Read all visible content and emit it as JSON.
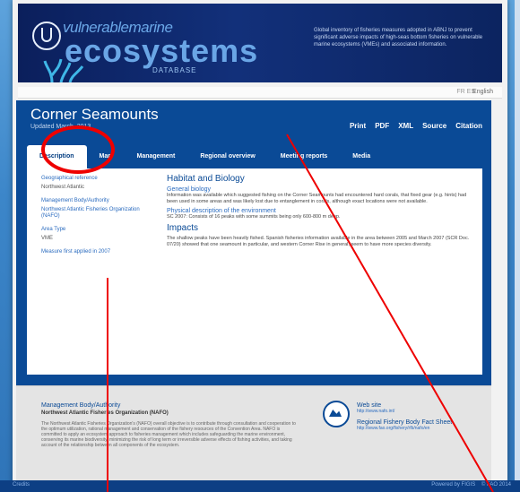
{
  "banner": {
    "brand_top": "vulnerable",
    "brand_top_small": "marine",
    "brand_main": "ecosystems",
    "brand_sub": "DATABASE",
    "description": "Global inventory of fisheries measures adopted in ABNJ to prevent significant adverse impacts of high-seas bottom fisheries on vulnerable marine ecosystems (VMEs) and associated information."
  },
  "status": {
    "language": "English",
    "link": "FR  ES"
  },
  "header": {
    "title": "Corner Seamounts",
    "subtitle": "Updated March, 2013",
    "links": [
      "Print",
      "PDF",
      "XML",
      "Source",
      "Citation"
    ]
  },
  "tabs": [
    "Description",
    "Map",
    "Management",
    "Regional overview",
    "Meeting reports",
    "Media"
  ],
  "left": {
    "geo_label": "Geographical reference",
    "geo_value": "Northwest Atlantic",
    "mgmt_label": "Management Body/Authority",
    "mgmt_value": "Northwest Atlantic Fisheries Organization (NAFO)",
    "area_label": "Area Type",
    "area_value": "VME",
    "measure": "Measure first applied in 2007"
  },
  "main": {
    "habitat": "Habitat and Biology",
    "general": "General biology",
    "general_text": "Information was available which suggested fishing on the Corner Seamounts had encountered hard corals, that fixed gear (e.g. hints) had been used in some areas and was likely lost due to entanglement in corals, although exact locations were not available.",
    "physical": "Physical description of the environment",
    "physical_text": "SC 2007: Consists of 16 peaks with some summits being only 600-800 m deep.",
    "impacts": "Impacts",
    "impacts_text": "The shallow peaks have been heavily fished. Spanish fisheries information available in the area between 2005 and March 2007 (SCR Doc. 07/20) showed that one seamount in particular, and western Corner Rise in general, seem to have more species diversity."
  },
  "footer": {
    "title": "Management Body/Authority",
    "org": "Northwest Atlantic Fisheries Organization (NAFO)",
    "desc": "The Northwest Atlantic Fisheries Organization's (NAFO) overall objective is to contribute through consultation and cooperation to the optimum utilization, rational management and conservation of the fishery resources of the Convention Area. NAFO is committed to apply an ecosystem approach to fisheries management which includes safeguarding the marine environment, conserving its marine biodiversity, minimizing the risk of long term or irreversible adverse effects of fishing activities, and taking account of the relationship between all components of the ecosystem.",
    "web_title": "Web site",
    "web_link": "http://www.nafo.int/",
    "rfb_title": "Regional Fishery Body Fact Sheet",
    "rfb_link": "http://www.fao.org/fishery/rfb/nafo/en"
  },
  "bottom": {
    "left": "Credits",
    "right1": "Powered by FIGIS",
    "right2": "© FAO 2014"
  }
}
